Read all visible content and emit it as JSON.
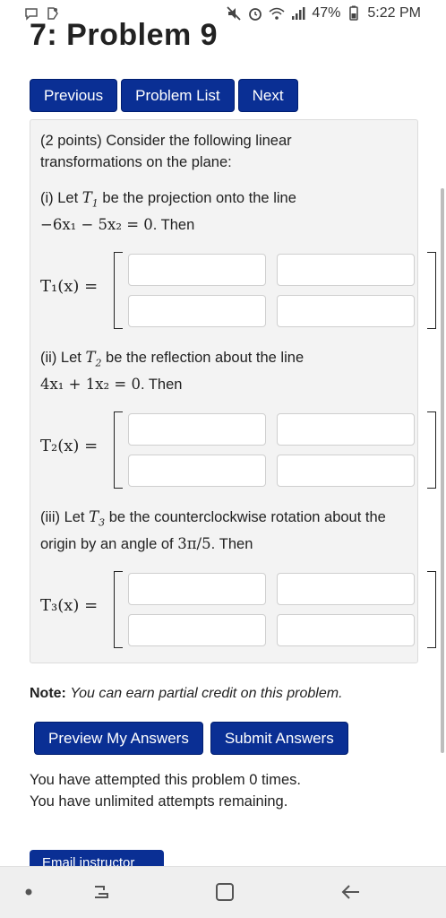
{
  "status": {
    "battery": "47%",
    "time": "5:22 PM"
  },
  "page_title": "7: Problem 9",
  "nav": {
    "previous": "Previous",
    "problem_list": "Problem List",
    "next": "Next"
  },
  "problem": {
    "intro_line1": "(2 points) Consider the following linear",
    "intro_line2": "transformations on the plane:",
    "part1_prefix": "(i) Let",
    "part1_mid": "be the projection onto the line",
    "part1_eq": "−6x₁ − 5x₂ = 0",
    "part1_then": ". Then",
    "part2_prefix": "(ii) Let",
    "part2_mid": "be the reflection about the line",
    "part2_eq": "4x₁ + 1x₂ = 0",
    "part2_then": ". Then",
    "part3_prefix": "(iii) Let",
    "part3_mid": "be the counterclockwise rotation about the",
    "part3_line2_prefix": "origin by an angle of",
    "part3_angle": "3π/5",
    "part3_then": ". Then",
    "t1_label": "T₁(x) =",
    "t2_label": "T₂(x) =",
    "t3_label": "T₃(x) =",
    "t1": "T",
    "vec_x": "x"
  },
  "note": {
    "label": "Note:",
    "text": "You can earn partial credit on this problem."
  },
  "actions": {
    "preview": "Preview My Answers",
    "submit": "Submit Answers"
  },
  "attempts": {
    "line1": "You have attempted this problem 0 times.",
    "line2": "You have unlimited attempts remaining."
  },
  "email_button": "Email instructor",
  "colors": {
    "button_bg": "#0a2f94",
    "problem_bg": "#f3f3f3"
  }
}
